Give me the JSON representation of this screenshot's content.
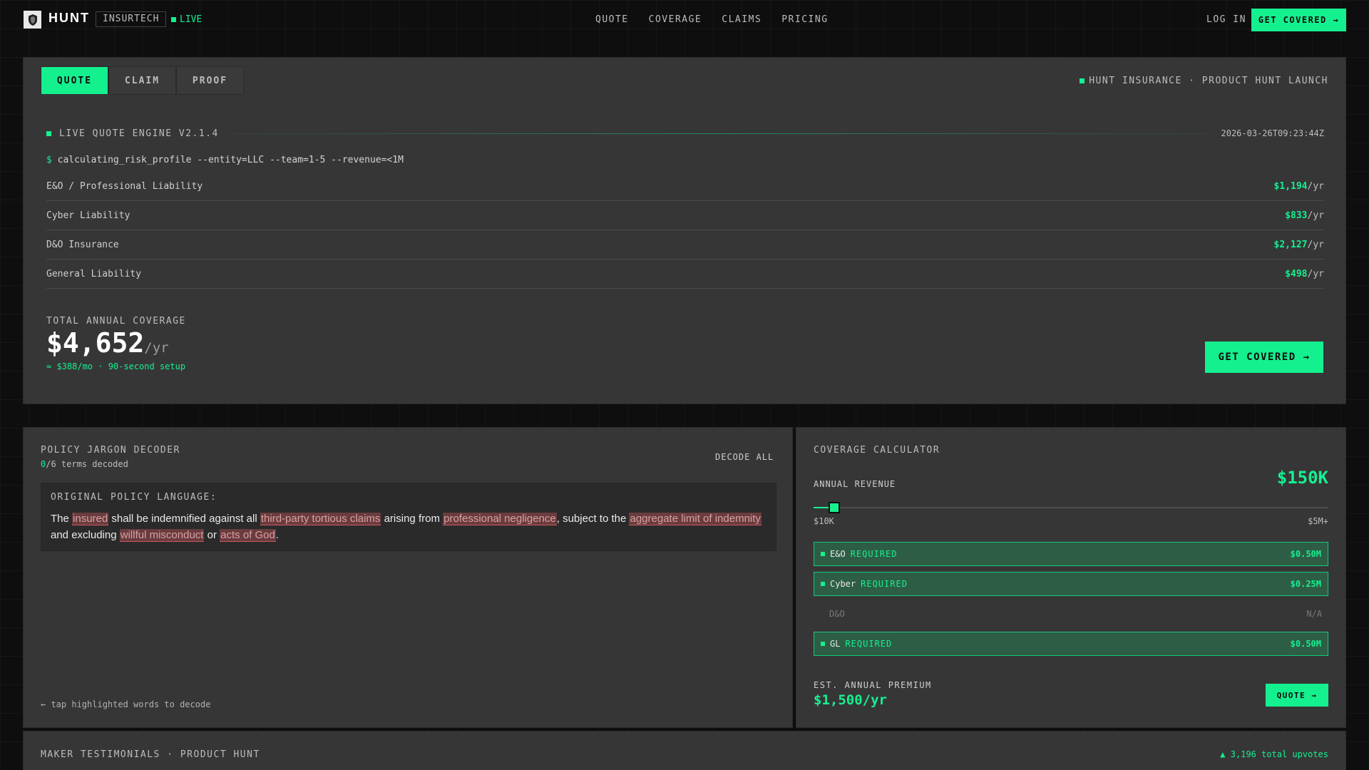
{
  "nav": {
    "brand": "HUNT",
    "tag": "INSURTECH",
    "live": "LIVE",
    "links": [
      "QUOTE",
      "COVERAGE",
      "CLAIMS",
      "PRICING"
    ],
    "login": "LOG IN",
    "cta": "GET COVERED →"
  },
  "quote_panel": {
    "tabs": [
      "QUOTE",
      "CLAIM",
      "PROOF"
    ],
    "active_tab": "QUOTE",
    "launch": "HUNT INSURANCE · PRODUCT HUNT LAUNCH",
    "engine_label": "LIVE QUOTE ENGINE V2.1.4",
    "timestamp": "2026-03-26T09:23:44Z",
    "prompt": "$",
    "command": "calculating_risk_profile --entity=LLC --team=1-5 --revenue=<1M",
    "lines": [
      {
        "name": "E&O / Professional Liability",
        "price": "$1,194",
        "unit": "/yr"
      },
      {
        "name": "Cyber Liability",
        "price": "$833",
        "unit": "/yr"
      },
      {
        "name": "D&O Insurance",
        "price": "$2,127",
        "unit": "/yr"
      },
      {
        "name": "General Liability",
        "price": "$498",
        "unit": "/yr"
      }
    ],
    "total_label": "TOTAL ANNUAL COVERAGE",
    "total_value": "$4,652",
    "total_unit": "/yr",
    "total_sub": "≈ $388/mo · 90-second setup",
    "cta": "GET COVERED →"
  },
  "decoder": {
    "title": "POLICY JARGON DECODER",
    "decoded_count": "0",
    "decoded_suffix": "/6 terms decoded",
    "decode_all": "DECODE ALL",
    "orig_label": "ORIGINAL POLICY LANGUAGE:",
    "text": {
      "t1": "The ",
      "h1": "insured",
      "t2": " shall be indemnified against all ",
      "h2": "third-party tortious claims",
      "t3": " arising from ",
      "h3": "professional negligence",
      "t4": ", subject to the ",
      "h4": "aggregate limit of indemnity",
      "t5": " and excluding ",
      "h5": "willful misconduct",
      "t6": " or ",
      "h6": "acts of God",
      "t7": "."
    },
    "hint": "← tap highlighted words to decode"
  },
  "calculator": {
    "title": "COVERAGE CALCULATOR",
    "revenue_label": "ANNUAL REVENUE",
    "revenue_value": "$150K",
    "slider_fraction": 0.04,
    "min_label": "$10K",
    "max_label": "$5M+",
    "coverages": [
      {
        "name": "E&O",
        "status": "REQUIRED",
        "amount": "$0.50M",
        "required": true
      },
      {
        "name": "Cyber",
        "status": "REQUIRED",
        "amount": "$0.25M",
        "required": true
      },
      {
        "name": "D&O",
        "status": "",
        "amount": "N/A",
        "required": false
      },
      {
        "name": "GL",
        "status": "REQUIRED",
        "amount": "$0.50M",
        "required": true
      }
    ],
    "est_label": "EST. ANNUAL PREMIUM",
    "est_value": "$1,500/yr",
    "quote_button": "QUOTE →"
  },
  "testimonials": {
    "title": "MAKER TESTIMONIALS · PRODUCT HUNT",
    "upvotes": "▲ 3,196 total upvotes"
  },
  "colors": {
    "accent": "#15f08f",
    "panel": "#363637",
    "background": "#0e0e0e",
    "highlight": "#6a3c3e"
  }
}
